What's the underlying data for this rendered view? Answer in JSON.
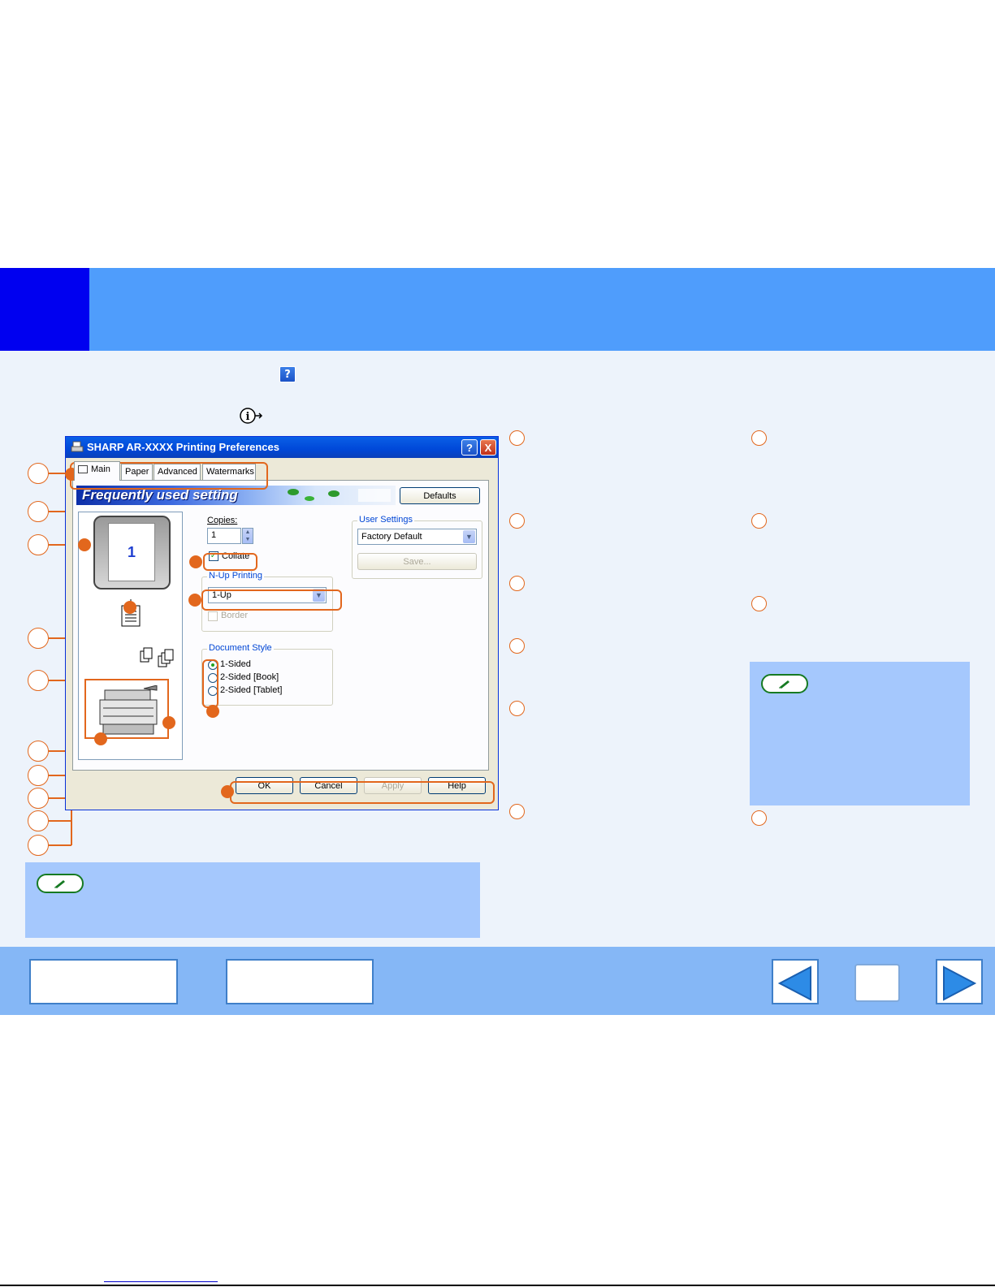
{
  "dialog": {
    "title": "SHARP AR-XXXX Printing Preferences",
    "help_button": "?",
    "close_button": "X",
    "tabs": [
      {
        "label": "Main"
      },
      {
        "label": "Paper"
      },
      {
        "label": "Advanced"
      },
      {
        "label": "Watermarks"
      }
    ],
    "banner_text": "Frequently used setting",
    "defaults_label": "Defaults",
    "copies_label": "Copies:",
    "copies_value": "1",
    "collate_label": "Collate",
    "collate_checked": true,
    "preview_page_number": "1",
    "user_settings": {
      "group_label": "User Settings",
      "selected": "Factory Default",
      "save_label": "Save..."
    },
    "nup": {
      "group_label": "N-Up Printing",
      "selected": "1-Up",
      "border_label": "Border"
    },
    "document_style": {
      "group_label": "Document Style",
      "options": [
        {
          "label": "1-Sided",
          "checked": true
        },
        {
          "label": "2-Sided [Book]",
          "checked": false
        },
        {
          "label": "2-Sided [Tablet]",
          "checked": false
        }
      ]
    },
    "buttons": {
      "ok": "OK",
      "cancel": "Cancel",
      "apply": "Apply",
      "help": "Help"
    }
  },
  "colors": {
    "header_band": "#4f9dfc",
    "header_tab": "#0000f0",
    "content_bg": "#edf3fb",
    "footer_band": "#85b7f6",
    "note_box": "#a5c8fd",
    "callout": "#e2671d",
    "note_badge_border": "#167a22"
  },
  "icons": {
    "help_icon": "question-mark-square",
    "info_icon": "info-circle-arrow",
    "note_icon": "pencil",
    "prev_icon": "left-triangle",
    "next_icon": "right-triangle"
  }
}
